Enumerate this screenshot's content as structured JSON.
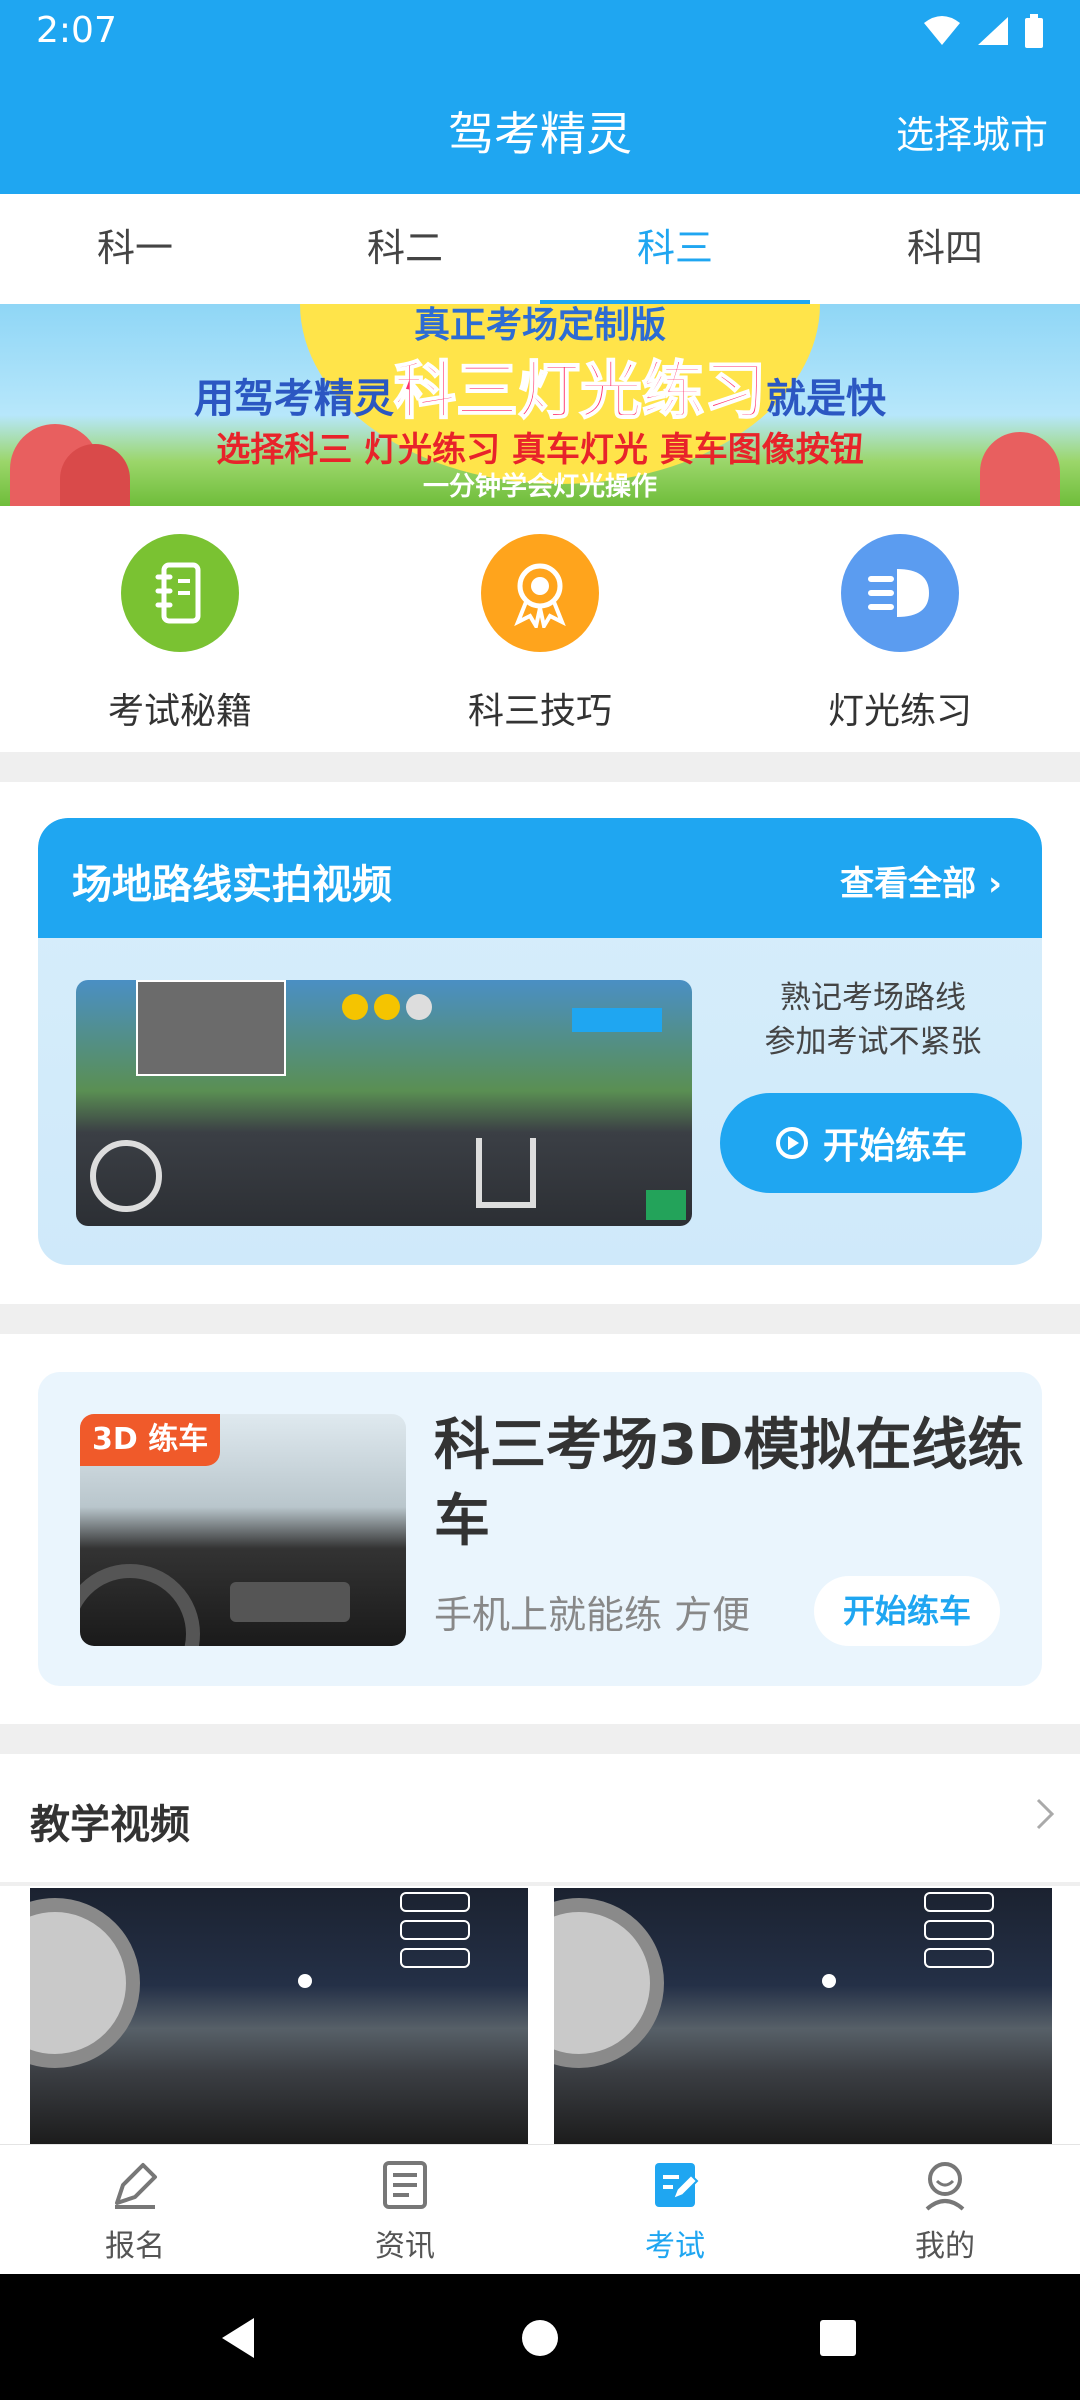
{
  "status_bar": {
    "time": "2:07"
  },
  "header": {
    "title": "驾考精灵",
    "city_button": "选择城市"
  },
  "tabs": [
    {
      "label": "科一",
      "active": false
    },
    {
      "label": "科二",
      "active": false
    },
    {
      "label": "科三",
      "active": true
    },
    {
      "label": "科四",
      "active": false
    }
  ],
  "banner": {
    "top_text": "真正考场定制版",
    "line_pre": "用驾考精灵",
    "line_main": "科三灯光练习",
    "line_post": "就是快",
    "sub_text": "选择科三 灯光练习 真车灯光 真车图像按钮",
    "note_text": "一分钟学会灯光操作"
  },
  "quick_links": [
    {
      "label": "考试秘籍",
      "icon": "notebook-icon",
      "color": "#7ac232"
    },
    {
      "label": "科三技巧",
      "icon": "award-medal-icon",
      "color": "#ffa41c"
    },
    {
      "label": "灯光练习",
      "icon": "headlight-icon",
      "color": "#5b9cf0"
    }
  ],
  "route_video": {
    "title": "场地路线实拍视频",
    "view_all": "查看全部 ›",
    "desc_line1": "熟记考场路线",
    "desc_line2": "参加考试不紧张",
    "start_button": "开始练车"
  },
  "sim_3d": {
    "badge": "3D 练车",
    "title": "科三考场3D模拟在线练车",
    "subtitle": "手机上就能练 方便",
    "button": "开始练车"
  },
  "teaching_videos": {
    "title": "教学视频"
  },
  "bottom_nav": [
    {
      "label": "报名",
      "icon": "pen-icon",
      "active": false
    },
    {
      "label": "资讯",
      "icon": "news-icon",
      "active": false
    },
    {
      "label": "考试",
      "icon": "exam-icon",
      "active": true
    },
    {
      "label": "我的",
      "icon": "profile-icon",
      "active": false
    }
  ],
  "colors": {
    "brand": "#1fa6f1",
    "divider": "#efefef"
  }
}
